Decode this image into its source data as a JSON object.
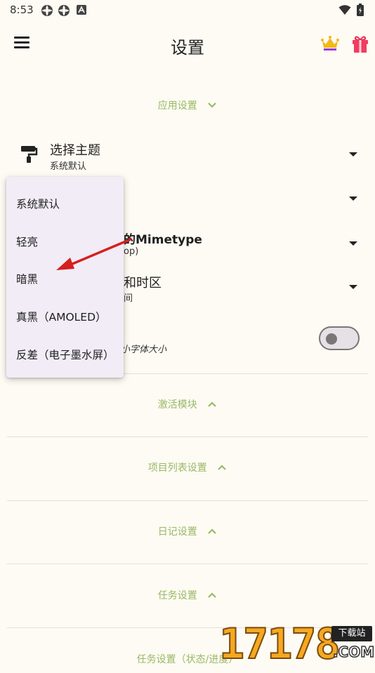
{
  "status_bar": {
    "time": "8:53"
  },
  "app_bar": {
    "title": "设置"
  },
  "sections": {
    "app_settings": "应用设置",
    "modules": "激活模块",
    "project_list": "项目列表设置",
    "diary": "日记设置",
    "tasks": "任务设置",
    "task_status": "任务设置（状态/进度）"
  },
  "settings": {
    "theme": {
      "title": "选择主题",
      "value": "系统默认"
    },
    "mimetype": {
      "title_partial": "的Mimetype",
      "sub_partial": "op)"
    },
    "timezone": {
      "title_partial": "和时区",
      "sub_partial": "间"
    },
    "font_size": {
      "sub_partial": "小字体大小"
    }
  },
  "theme_menu": {
    "options": [
      "系统默认",
      "轻亮",
      "暗黑",
      "真黑（AMOLED）",
      "反差（电子墨水屏）"
    ]
  },
  "watermark": {
    "number": "17178",
    "tag": "下载站",
    "domain": ".COM"
  },
  "colors": {
    "accent": "#9ab865",
    "background": "#fdfbf3",
    "popup": "#f1ecf6",
    "arrow": "#d61f1f"
  }
}
